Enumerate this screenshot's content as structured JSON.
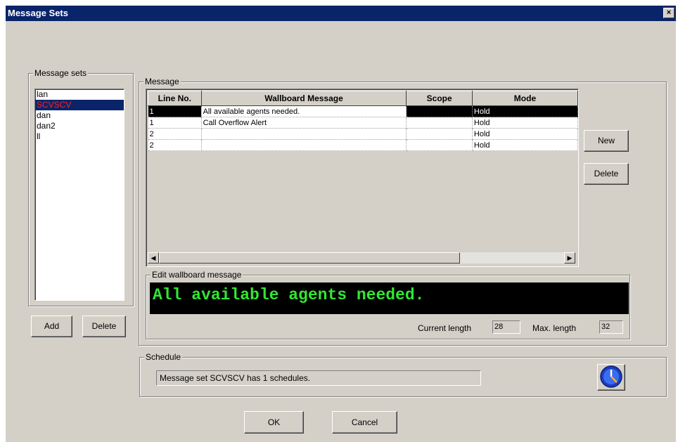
{
  "window": {
    "title": "Message Sets",
    "close_glyph": "×"
  },
  "message_sets": {
    "legend": "Message sets",
    "items": [
      "lan",
      "SCVSCV",
      "dan",
      "dan2",
      "ll"
    ],
    "selected_index": 1,
    "add_label": "Add",
    "delete_label": "Delete"
  },
  "message": {
    "legend": "Message",
    "columns": [
      "Line No.",
      "Wallboard Message",
      "Scope",
      "Mode"
    ],
    "rows": [
      {
        "line": "1",
        "text": "All available agents needed.",
        "scope": "",
        "mode": "Hold"
      },
      {
        "line": "1",
        "text": "Call Overflow Alert",
        "scope": "",
        "mode": "Hold"
      },
      {
        "line": "2",
        "text": "",
        "scope": "",
        "mode": "Hold"
      },
      {
        "line": "2",
        "text": "",
        "scope": "",
        "mode": "Hold"
      }
    ],
    "new_label": "New",
    "delete_label": "Delete"
  },
  "edit": {
    "legend": "Edit wallboard message",
    "display_text": "All available agents needed.",
    "current_length_label": "Current length",
    "current_length": "28",
    "max_length_label": "Max. length",
    "max_length": "32"
  },
  "schedule": {
    "legend": "Schedule",
    "status": "Message set SCVSCV has 1 schedules.",
    "icon": "clock-icon"
  },
  "footer": {
    "ok_label": "OK",
    "cancel_label": "Cancel"
  },
  "colors": {
    "titlebar": "#0a246a",
    "led_text": "#33e633",
    "selected_text": "#ff2020"
  }
}
